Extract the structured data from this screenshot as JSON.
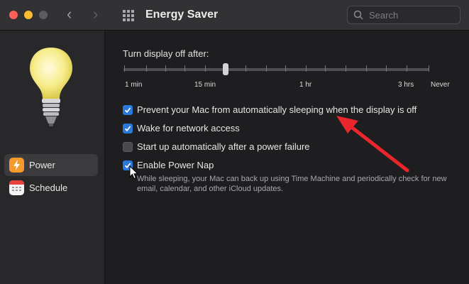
{
  "window": {
    "title": "Energy Saver",
    "search_placeholder": "Search"
  },
  "sidebar": {
    "items": [
      {
        "label": "Power",
        "icon": "power-bolt-icon",
        "selected": true
      },
      {
        "label": "Schedule",
        "icon": "calendar-icon",
        "selected": false
      }
    ]
  },
  "display_sleep": {
    "heading": "Turn display off after:",
    "labels": [
      "1 min",
      "15 min",
      "1 hr",
      "3 hrs",
      "Never"
    ],
    "current_value": "15 min"
  },
  "options": [
    {
      "label": "Prevent your Mac from automatically sleeping when the display is off",
      "checked": true
    },
    {
      "label": "Wake for network access",
      "checked": true
    },
    {
      "label": "Start up automatically after a power failure",
      "checked": false
    },
    {
      "label": "Enable Power Nap",
      "checked": true
    }
  ],
  "power_nap_description": "While sleeping, your Mac can back up using Time Machine and periodically check for new email, calendar, and other iCloud updates.",
  "colors": {
    "accent": "#2a78d8",
    "annotation_arrow": "#e8262b",
    "power_icon": "#f39a2b"
  }
}
